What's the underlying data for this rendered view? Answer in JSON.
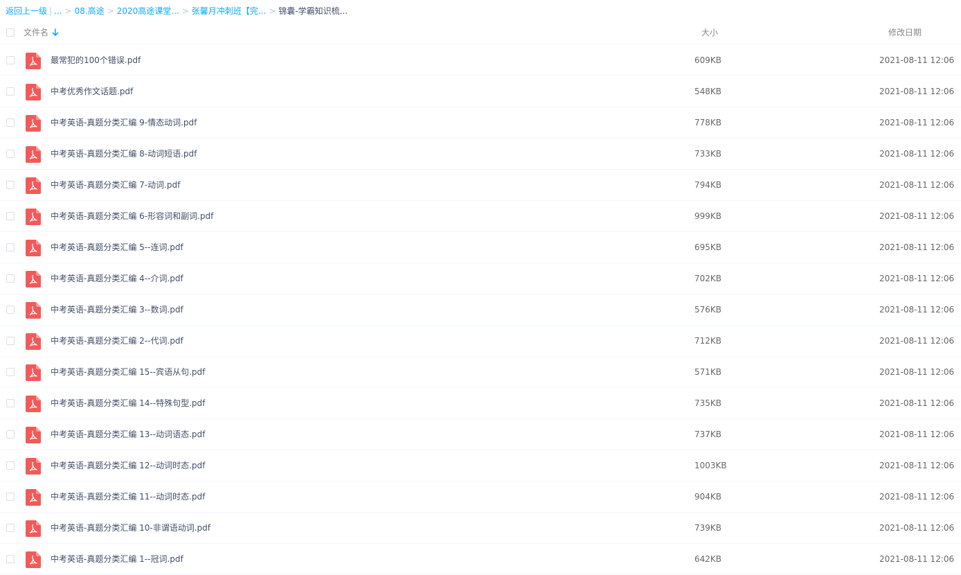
{
  "breadcrumb": {
    "back": "返回上一级",
    "pipe": "|",
    "ellipsis": "...",
    "separator": ">",
    "items": [
      "08.高途",
      "2020高途课堂...",
      "张馨月冲刺班【完..."
    ],
    "current": "锦囊-学霸知识梳..."
  },
  "header": {
    "name": "文件名",
    "size": "大小",
    "date": "修改日期",
    "sort_icon": "arrow-down-icon"
  },
  "files": [
    {
      "name": "最常犯的100个错误.pdf",
      "size": "609KB",
      "date": "2021-08-11 12:06"
    },
    {
      "name": "中考优秀作文话题.pdf",
      "size": "548KB",
      "date": "2021-08-11 12:06"
    },
    {
      "name": "中考英语-真题分类汇编 9-情态动词.pdf",
      "size": "778KB",
      "date": "2021-08-11 12:06"
    },
    {
      "name": "中考英语-真题分类汇编 8-动词短语.pdf",
      "size": "733KB",
      "date": "2021-08-11 12:06"
    },
    {
      "name": "中考英语-真题分类汇编 7-动词.pdf",
      "size": "794KB",
      "date": "2021-08-11 12:06"
    },
    {
      "name": "中考英语-真题分类汇编 6-形容词和副词.pdf",
      "size": "999KB",
      "date": "2021-08-11 12:06"
    },
    {
      "name": "中考英语-真题分类汇编 5--连词.pdf",
      "size": "695KB",
      "date": "2021-08-11 12:06"
    },
    {
      "name": "中考英语-真题分类汇编 4--介词.pdf",
      "size": "702KB",
      "date": "2021-08-11 12:06"
    },
    {
      "name": "中考英语-真题分类汇编 3--数词.pdf",
      "size": "576KB",
      "date": "2021-08-11 12:06"
    },
    {
      "name": "中考英语-真题分类汇编 2--代词.pdf",
      "size": "712KB",
      "date": "2021-08-11 12:06"
    },
    {
      "name": "中考英语-真题分类汇编 15--宾语从句.pdf",
      "size": "571KB",
      "date": "2021-08-11 12:06"
    },
    {
      "name": "中考英语-真题分类汇编 14--特殊句型.pdf",
      "size": "735KB",
      "date": "2021-08-11 12:06"
    },
    {
      "name": "中考英语-真题分类汇编 13--动词语态.pdf",
      "size": "737KB",
      "date": "2021-08-11 12:06"
    },
    {
      "name": "中考英语-真题分类汇编 12--动词时态.pdf",
      "size": "1003KB",
      "date": "2021-08-11 12:06"
    },
    {
      "name": "中考英语-真题分类汇编 11--动词时态.pdf",
      "size": "904KB",
      "date": "2021-08-11 12:06"
    },
    {
      "name": "中考英语-真题分类汇编 10-非谓语动词.pdf",
      "size": "739KB",
      "date": "2021-08-11 12:06"
    },
    {
      "name": "中考英语-真题分类汇编 1--冠词.pdf",
      "size": "642KB",
      "date": "2021-08-11 12:06"
    }
  ],
  "colors": {
    "link": "#09aaff",
    "pdf_icon": "#f25a5a",
    "text": "#424e67"
  },
  "icons": {
    "file": "pdf-file-icon"
  }
}
